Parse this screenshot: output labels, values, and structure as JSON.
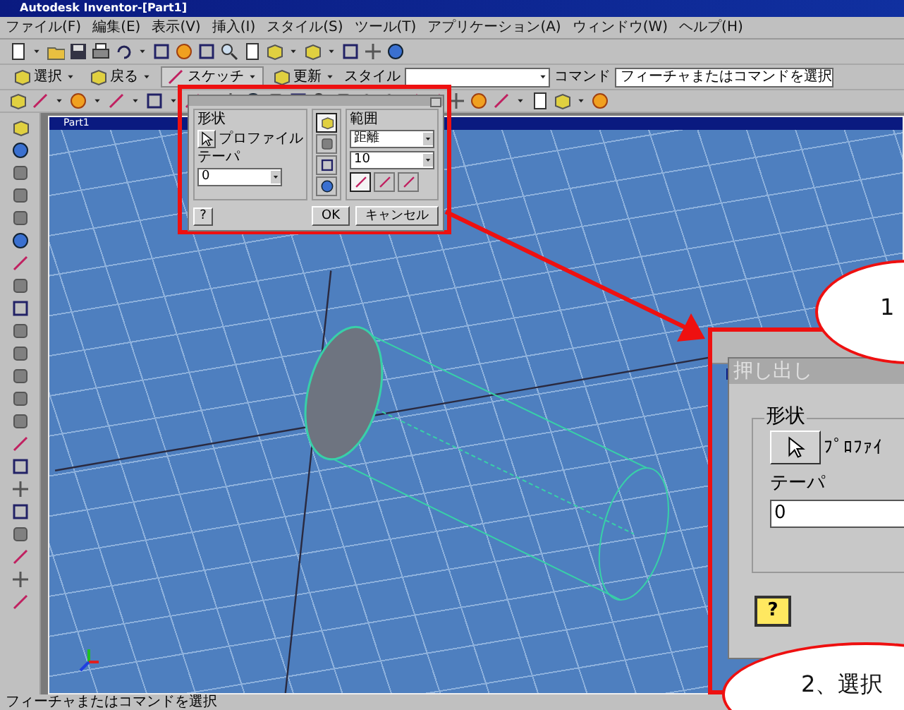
{
  "window": {
    "title": "Autodesk Inventor-[Part1]"
  },
  "menu": [
    {
      "label": "ファイル(F)"
    },
    {
      "label": "編集(E)"
    },
    {
      "label": "表示(V)"
    },
    {
      "label": "挿入(I)"
    },
    {
      "label": "スタイル(S)"
    },
    {
      "label": "ツール(T)"
    },
    {
      "label": "アプリケーション(A)"
    },
    {
      "label": "ウィンドウ(W)"
    },
    {
      "label": "ヘルプ(H)"
    }
  ],
  "command_bar": {
    "items": [
      {
        "label": "選択",
        "kind": "button"
      },
      {
        "label": "戻る",
        "kind": "button"
      },
      {
        "label": "スケッチ",
        "kind": "combo"
      },
      {
        "label": "更新",
        "kind": "button"
      }
    ],
    "style_label": "スタイル",
    "message_label": "コマンド",
    "message": "フィーチャまたはコマンドを選択"
  },
  "part_window": {
    "title": "Part1"
  },
  "small_dialog": {
    "shape_label": "形状",
    "profile_label": "プロファイル",
    "taper_label": "テーパ",
    "taper_value": "0",
    "extents_label": "範囲",
    "extents_type": "距離",
    "distance": "10",
    "help": "?",
    "ok": "OK",
    "cancel": "キャンセル",
    "operations": [
      {
        "selected": true
      },
      {
        "selected": false
      },
      {
        "selected": false
      },
      {
        "selected": false
      }
    ],
    "directions": [
      {
        "selected": true
      },
      {
        "selected": false
      },
      {
        "selected": false
      }
    ]
  },
  "enlarged_dialog": {
    "title": "押し出し",
    "shape_label": "形状",
    "profile_label": "ﾌﾟﾛﾌｧｲ",
    "taper_label": "テーパ",
    "taper_value": "0",
    "help": "?"
  },
  "callouts": [
    {
      "text": "1"
    },
    {
      "text": "2、選択"
    }
  ],
  "status_bar": {
    "text": "フィーチャまたはコマンドを選択"
  }
}
